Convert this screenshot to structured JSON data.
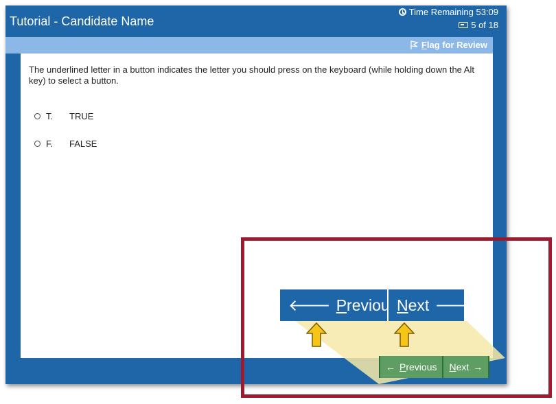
{
  "window": {
    "title": "Tutorial - Candidate Name",
    "timer_label": "Time Remaining 53:09",
    "progress_label": "5 of 18"
  },
  "flag": {
    "key": "F",
    "rest": "lag for Review"
  },
  "question": {
    "text": "The underlined letter in a button indicates the letter you should press on the keyboard (while holding down the Alt key) to select a button.",
    "options": [
      {
        "letter": "T.",
        "label": "TRUE"
      },
      {
        "letter": "F.",
        "label": "FALSE"
      }
    ]
  },
  "nav_small": {
    "previous_key": "P",
    "previous_rest": "revious",
    "next_key": "N",
    "next_rest": "ext"
  },
  "nav_zoom": {
    "previous_key": "P",
    "previous_rest": "revious",
    "next_key": "N",
    "next_rest": "ext"
  },
  "icons": {
    "timer": "clock-icon",
    "progress": "progress-icon",
    "flag": "flag-icon",
    "arrow_left": "arrow-left-icon",
    "arrow_right": "arrow-right-icon",
    "arrow_up": "arrow-up-icon"
  },
  "colors": {
    "window_blue": "#1e66a8",
    "flag_bar": "#8bb8e6",
    "nav_green": "#5e9e63",
    "callout_border": "#9b1c31",
    "highlight_yellow": "#f6e9a8",
    "pointer_arrow": "#f5c518"
  }
}
